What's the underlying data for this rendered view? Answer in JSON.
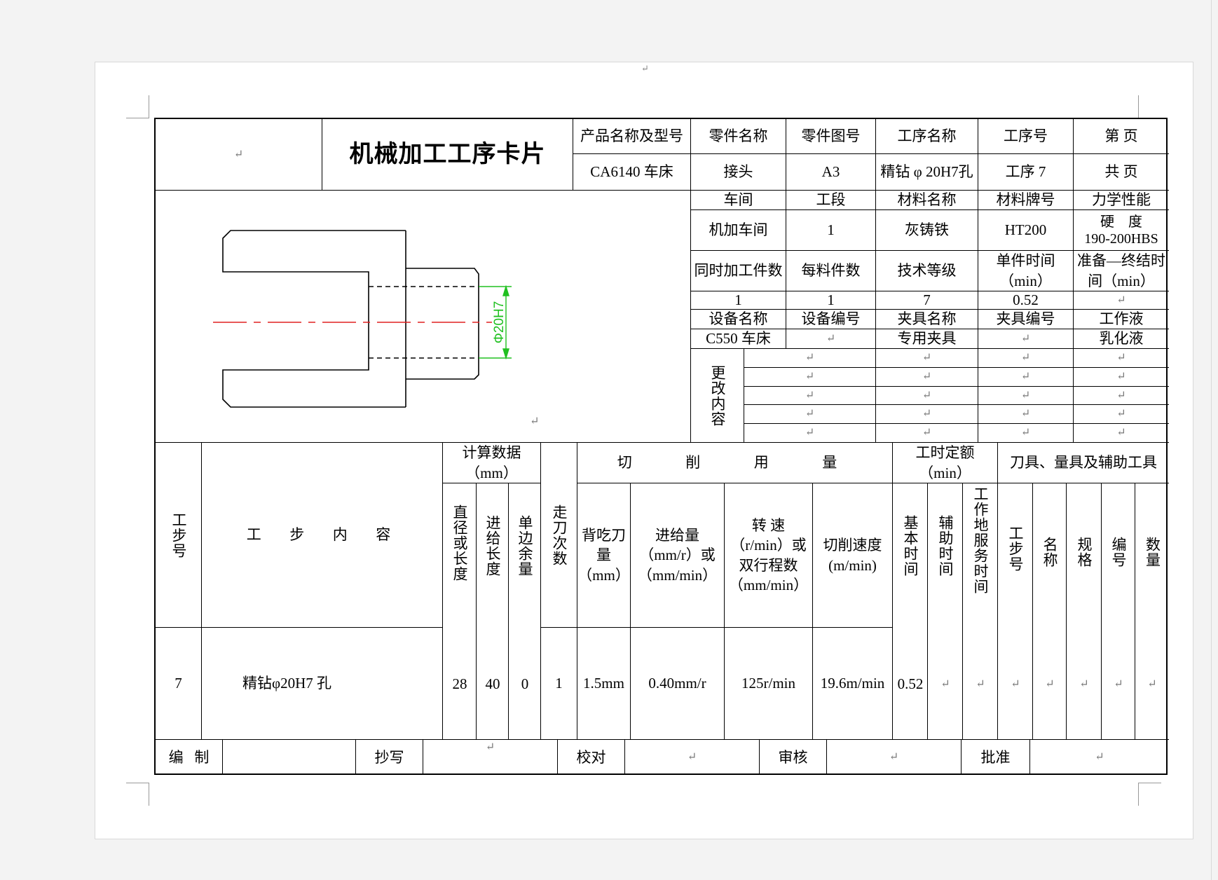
{
  "header": {
    "title": "机械加工工序卡片",
    "product_label": "产品名称及型号",
    "product_value": "CA6140 车床",
    "part_name_label": "零件名称",
    "part_name_value": "接头",
    "part_no_label": "零件图号",
    "part_no_value": "A3",
    "op_name_label": "工序名称",
    "op_name_value": "精钻 φ 20H7孔",
    "op_no_label": "工序号",
    "op_no_value": "工序 7",
    "page_label": "第  页",
    "total_label": "共   页"
  },
  "info": {
    "workshop_label": "车间",
    "section_label": "工段",
    "material_name_label": "材料名称",
    "material_grade_label": "材料牌号",
    "mech_label": "力学性能",
    "workshop_value": "机加车间",
    "section_value": "1",
    "material_name_value": "灰铸铁",
    "material_grade_value": "HT200",
    "hardness_label": "硬    度",
    "hardness_value": "190-200HBS",
    "simul_label": "同时加工件数",
    "per_blank_label": "每料件数",
    "tech_grade_label": "技术等级",
    "unit_time_label": "单件时间（min）",
    "prep_time_label": "准备—终结时间（min）",
    "simul_value": "1",
    "per_blank_value": "1",
    "tech_grade_value": "7",
    "unit_time_value": "0.52",
    "equip_name_label": "设备名称",
    "equip_no_label": "设备编号",
    "fixture_name_label": "夹具名称",
    "fixture_no_label": "夹具编号",
    "coolant_label": "工作液",
    "equip_name_value": "C550 车床",
    "fixture_name_value": "专用夹具",
    "coolant_value": "乳化液",
    "change_label": "更改内容"
  },
  "drawing": {
    "dim_label": "Φ20H7"
  },
  "steps": {
    "step_no_label": "工步号",
    "content_label": "工  步  内  容",
    "calc_label": "计算数据（mm）",
    "dia_label": "直径或长度",
    "feed_len_label": "进给长度",
    "allow_label": "单边余量",
    "passes_label": "走刀次数",
    "cutting_label": "切  削  用  量",
    "depth_label": "背吃刀量（mm）",
    "feed_label": "进给量（mm/r）或（mm/min）",
    "speed_label": "转 速（r/min）或双行程数（mm/min）",
    "vel_label": "切削速度(m/min)",
    "time_label": "工时定额（min）",
    "basic_time_label": "基本时间",
    "aux_time_label": "辅助时间",
    "service_time_label": "工作地服务时间",
    "tools_label": "刀具、量具及辅助工具",
    "tool_step_label": "工步号",
    "tool_name_label": "名称",
    "tool_spec_label": "规格",
    "tool_no_label": "编号",
    "tool_qty_label": "数量",
    "row": {
      "step_no": "7",
      "content": "精钻φ20H7 孔",
      "dia": "28",
      "feed_len": "40",
      "allow": "0",
      "passes": "1",
      "depth": "1.5mm",
      "feed": "0.40mm/r",
      "speed": "125r/min",
      "vel": "19.6m/min",
      "basic_time": "0.52"
    }
  },
  "footer": {
    "compile_label": "编   制",
    "copy_label": "抄写",
    "check_label": "校对",
    "review_label": "审核",
    "approve_label": "批准"
  },
  "colors": {
    "centerline": "#e02020",
    "dimension": "#20c020"
  }
}
